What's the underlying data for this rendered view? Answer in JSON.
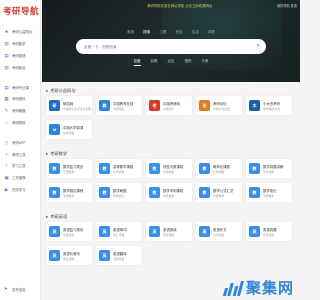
{
  "sidebar": {
    "logo": "考研导航",
    "items": [
      {
        "label": "考研公益网址",
        "icon": "star-icon"
      },
      {
        "label": "考研数学",
        "icon": "book-icon"
      },
      {
        "label": "考研英语",
        "icon": "book-icon"
      },
      {
        "label": "考研政治",
        "icon": "book-icon"
      },
      {
        "label": "考研专业课",
        "icon": "book-icon"
      },
      {
        "label": "考研资讯",
        "icon": "news-icon"
      },
      {
        "label": "考研刷题",
        "icon": "edit-icon"
      },
      {
        "label": "考研院校",
        "icon": "school-icon"
      },
      {
        "label": "考研APP",
        "icon": "phone-icon"
      },
      {
        "label": "考研工具",
        "icon": "tool-icon"
      },
      {
        "label": "学习工具",
        "icon": "tool-icon"
      },
      {
        "label": "工作推荐",
        "icon": "briefcase-icon"
      },
      {
        "label": "在线学习",
        "icon": "play-icon"
      }
    ],
    "bottom": {
      "label": "发布信息",
      "icon": "send-icon"
    }
  },
  "hero": {
    "notice": "考研导航收录至网址导航 点击立即收藏网址",
    "top_right": "我的导航  登录",
    "tabs": [
      {
        "label": "常用",
        "active": false
      },
      {
        "label": "搜索",
        "active": true
      },
      {
        "label": "工具",
        "active": false
      },
      {
        "label": "社区",
        "active": false
      },
      {
        "label": "生活",
        "active": false
      },
      {
        "label": "求职",
        "active": false
      }
    ],
    "search_placeholder": "百度一下，您就知道",
    "engines": [
      {
        "label": "百度",
        "active": true
      },
      {
        "label": "谷歌",
        "active": false
      },
      {
        "label": "必应",
        "active": false
      },
      {
        "label": "搜狗",
        "active": false
      },
      {
        "label": "头条",
        "active": false
      }
    ]
  },
  "sections": [
    {
      "title": "考研公益网址",
      "cards": [
        {
          "name": "研招网",
          "desc": "中国研究生招生信息网",
          "color": "#1d6fc4",
          "glyph": "研"
        },
        {
          "name": "中国教育在线",
          "desc": "考研频道",
          "color": "#2f86d6",
          "glyph": "教"
        },
        {
          "name": "中国考研网",
          "desc": "考研资讯",
          "color": "#d33a2c",
          "glyph": "考"
        },
        {
          "name": "考研论坛",
          "desc": "考研交流社区",
          "color": "#e07b22",
          "glyph": "论"
        },
        {
          "name": "小木虫考研",
          "desc": "学术科研交流",
          "color": "#1a5fa8",
          "glyph": "木"
        },
        {
          "name": "中国大学慕课",
          "desc": "在线课程",
          "color": "#2f86d6",
          "glyph": "M"
        }
      ]
    },
    {
      "title": "考研数学",
      "cards": [
        {
          "name": "数学复习规划",
          "desc": "考研数学",
          "color": "#3a8ee6",
          "glyph": "数"
        },
        {
          "name": "高等数学课程",
          "desc": "名师视频",
          "color": "#3a8ee6",
          "glyph": "数"
        },
        {
          "name": "线性代数课程",
          "desc": "名师视频",
          "color": "#3a8ee6",
          "glyph": "数"
        },
        {
          "name": "概率论课程",
          "desc": "名师视频",
          "color": "#3a8ee6",
          "glyph": "数"
        },
        {
          "name": "数学真题讲解",
          "desc": "历年真题",
          "color": "#3a8ee6",
          "glyph": "数"
        },
        {
          "name": "数学强化课程",
          "desc": "考研数学",
          "color": "#3a8ee6",
          "glyph": "数"
        },
        {
          "name": "数学刷题",
          "desc": "题库练习",
          "color": "#3a8ee6",
          "glyph": "数"
        },
        {
          "name": "数学冲刺课程",
          "desc": "考研数学",
          "color": "#3a8ee6",
          "glyph": "数"
        },
        {
          "name": "数学公式汇总",
          "desc": "考研数学",
          "color": "#3a8ee6",
          "glyph": "数"
        },
        {
          "name": "数学笔记",
          "desc": "考研数学",
          "color": "#3a8ee6",
          "glyph": "数"
        }
      ]
    },
    {
      "title": "考研英语",
      "cards": [
        {
          "name": "英语复习规划",
          "desc": "考研英语",
          "color": "#3a8ee6",
          "glyph": "英"
        },
        {
          "name": "英语单词",
          "desc": "词汇背诵",
          "color": "#3a8ee6",
          "glyph": "英"
        },
        {
          "name": "英语阅读",
          "desc": "阅读理解",
          "color": "#3a8ee6",
          "glyph": "英"
        },
        {
          "name": "英语作文",
          "desc": "写作模板",
          "color": "#3a8ee6",
          "glyph": "英"
        },
        {
          "name": "英语真题",
          "desc": "历年真题",
          "color": "#3a8ee6",
          "glyph": "英"
        },
        {
          "name": "英语长难句",
          "desc": "语法讲解",
          "color": "#3a8ee6",
          "glyph": "英"
        },
        {
          "name": "英语翻译",
          "desc": "考研英语",
          "color": "#3a8ee6",
          "glyph": "英"
        }
      ]
    }
  ],
  "watermark": "聚集网"
}
